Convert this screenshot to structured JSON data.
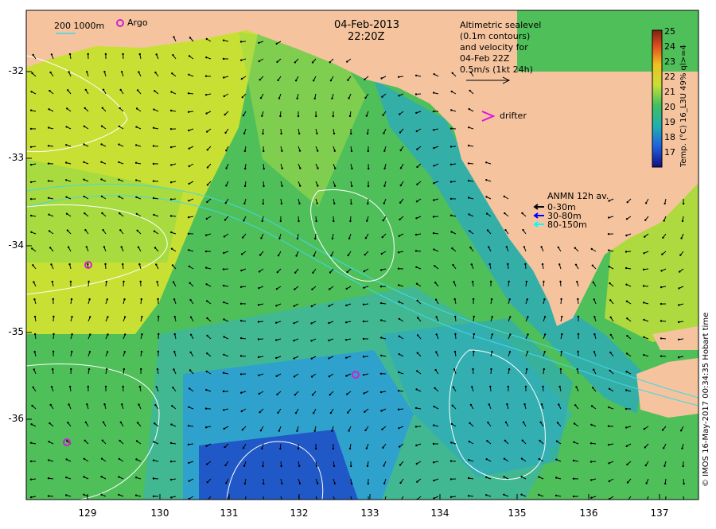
{
  "header": {
    "date": "04-Feb-2013",
    "time": "22:20Z"
  },
  "scale_legend": {
    "isobath_label": "200  1000m",
    "argo_label": "Argo"
  },
  "info_box": {
    "line1": "Altimetric sealevel",
    "line2": "(0.1m contours)",
    "line3": "and velocity for",
    "line4": "04-Feb 22Z",
    "line5": "0.5m/s (1kt 24h)"
  },
  "drifter_label": "drifter",
  "anmn": {
    "title": "ANMN 12h av.",
    "rows": [
      {
        "label": "0-30m",
        "color": "#000000"
      },
      {
        "label": "30-80m",
        "color": "#0000ff"
      },
      {
        "label": "80-150m",
        "color": "#00ffff"
      }
    ]
  },
  "colorbar": {
    "ticks": [
      "25",
      "24",
      "23",
      "22",
      "21",
      "20",
      "19",
      "18",
      "17"
    ],
    "label": "Temp. (°C) 16_L3U 49% ql>=4"
  },
  "axes": {
    "lat_ticks": [
      "-32",
      "-33",
      "-34",
      "-35",
      "-36"
    ],
    "lon_ticks": [
      "129",
      "130",
      "131",
      "132",
      "133",
      "134",
      "135",
      "136",
      "137"
    ]
  },
  "credit": "© IMOS 16-May-2017 00:34:35 Hobart time",
  "colors": {
    "land": "#f5c49e",
    "warm_sst": "#c8e034",
    "mid_sst": "#5cc456",
    "cool_sst": "#2aa8c8",
    "cold_sst": "#2040c0",
    "argo": "#d020d0",
    "drifter": "#e010e0",
    "contour": "#ffffff"
  }
}
